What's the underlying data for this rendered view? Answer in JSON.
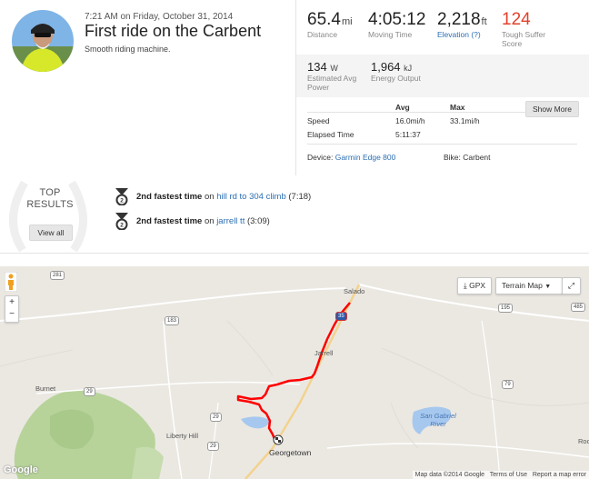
{
  "activity": {
    "datetime": "7:21 AM on Friday, October 31, 2014",
    "title": "First ride on the Carbent",
    "description": "Smooth riding machine."
  },
  "primary_stats": [
    {
      "value": "65.4",
      "unit": "mi",
      "label": "Distance"
    },
    {
      "value": "4:05:12",
      "unit": "",
      "label": "Moving Time"
    },
    {
      "value": "2,218",
      "unit": "ft",
      "label": "Elevation (?)"
    },
    {
      "value": "124",
      "unit": "",
      "label": "Tough Suffer Score"
    }
  ],
  "secondary_stats": [
    {
      "value": "134",
      "unit": "W",
      "label": "Estimated Avg Power"
    },
    {
      "value": "1,964",
      "unit": "kJ",
      "label": "Energy Output"
    }
  ],
  "table": {
    "headers": [
      "Avg",
      "Max"
    ],
    "rows": [
      {
        "label": "Speed",
        "avg": "16.0mi/h",
        "max": "33.1mi/h"
      },
      {
        "label": "Elapsed Time",
        "avg": "5:11:37",
        "max": ""
      }
    ],
    "show_more": "Show More"
  },
  "device": {
    "label": "Device:",
    "value": "Garmin Edge 800"
  },
  "bike": {
    "label": "Bike:",
    "value": "Carbent"
  },
  "top_results": {
    "title_line1": "TOP",
    "title_line2": "RESULTS",
    "view_all": "View all",
    "items": [
      {
        "rank": "2nd fastest time",
        "on": "on",
        "segment": "hill rd to 304 climb",
        "time": "(7:18)"
      },
      {
        "rank": "2nd fastest time",
        "on": "on",
        "segment": "jarrell tt",
        "time": "(3:09)"
      }
    ]
  },
  "map": {
    "gpx": "GPX",
    "map_type": "Terrain Map",
    "places": [
      "Salado",
      "Jarrell",
      "Burnet",
      "Liberty Hill",
      "Georgetown",
      "San Gabriel River",
      "Roc"
    ],
    "shields": [
      "281",
      "183",
      "29",
      "29",
      "195",
      "79",
      "485",
      "35"
    ],
    "attribution": [
      "Map data ©2014 Google",
      "Terms of Use",
      "Report a map error"
    ],
    "google": "Google",
    "route_color": "#ff0000"
  }
}
